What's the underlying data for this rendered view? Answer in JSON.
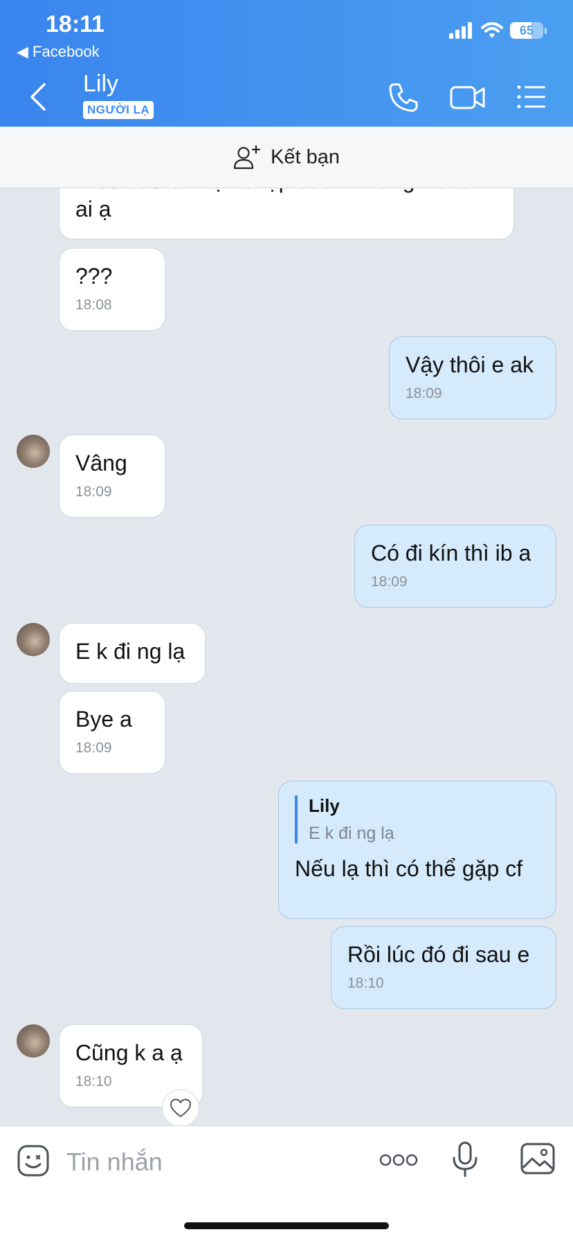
{
  "status_bar": {
    "time": "18:11",
    "back_app": "◀ Facebook",
    "battery": "65",
    "battery_level": 0.65
  },
  "header": {
    "contact_name": "Lily",
    "badge": "NGƯỜI LẠ"
  },
  "add_friend": {
    "label": "Kết bạn"
  },
  "messages": [
    {
      "dir": "in",
      "text_line1": "E có báo e nhận chặp đâu . Thằng kia là",
      "text_line2": "ai ạ"
    },
    {
      "dir": "in",
      "text": "???",
      "time": "18:08"
    },
    {
      "dir": "out",
      "text": "Vậy thôi e ak",
      "time": "18:09"
    },
    {
      "dir": "in",
      "text": "Vâng",
      "time": "18:09"
    },
    {
      "dir": "out",
      "text": "Có đi kín thì ib a",
      "time": "18:09"
    },
    {
      "dir": "in",
      "text": "E k đi ng lạ"
    },
    {
      "dir": "in",
      "text": "Bye a",
      "time": "18:09"
    },
    {
      "dir": "out",
      "quote_name": "Lily",
      "quote_text": "E k đi ng lạ",
      "text": "Nếu lạ thì có thể gặp cf"
    },
    {
      "dir": "out",
      "text": "Rồi lúc đó đi sau e",
      "time": "18:10"
    },
    {
      "dir": "in",
      "text": "Cũng k a ạ",
      "time": "18:10"
    }
  ],
  "composer": {
    "placeholder": "Tin nhắn"
  },
  "colors": {
    "header_start": "#3a85ee",
    "header_end": "#4b9ff0",
    "outgoing_bubble": "#d5eafb",
    "incoming_bubble": "#ffffff",
    "chat_bg": "#e2e7ee"
  }
}
